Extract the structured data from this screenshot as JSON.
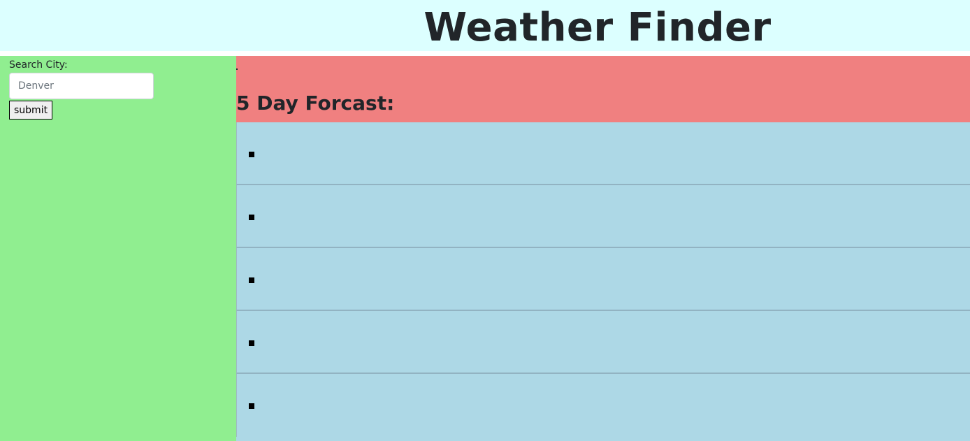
{
  "header": {
    "title": "Weather Finder"
  },
  "sidebar": {
    "search_label": "Search City:",
    "search_placeholder": "Denver",
    "search_value": "",
    "submit_label": "submit"
  },
  "current": {
    "city_text": ""
  },
  "forecast": {
    "heading": "5 Day Forcast:",
    "days": [
      "",
      "",
      "",
      "",
      ""
    ]
  },
  "colors": {
    "header_bg": "#dcffff",
    "sidebar_bg": "#90ee90",
    "current_bg": "#f08080",
    "forecast_bg": "#add8e6"
  }
}
